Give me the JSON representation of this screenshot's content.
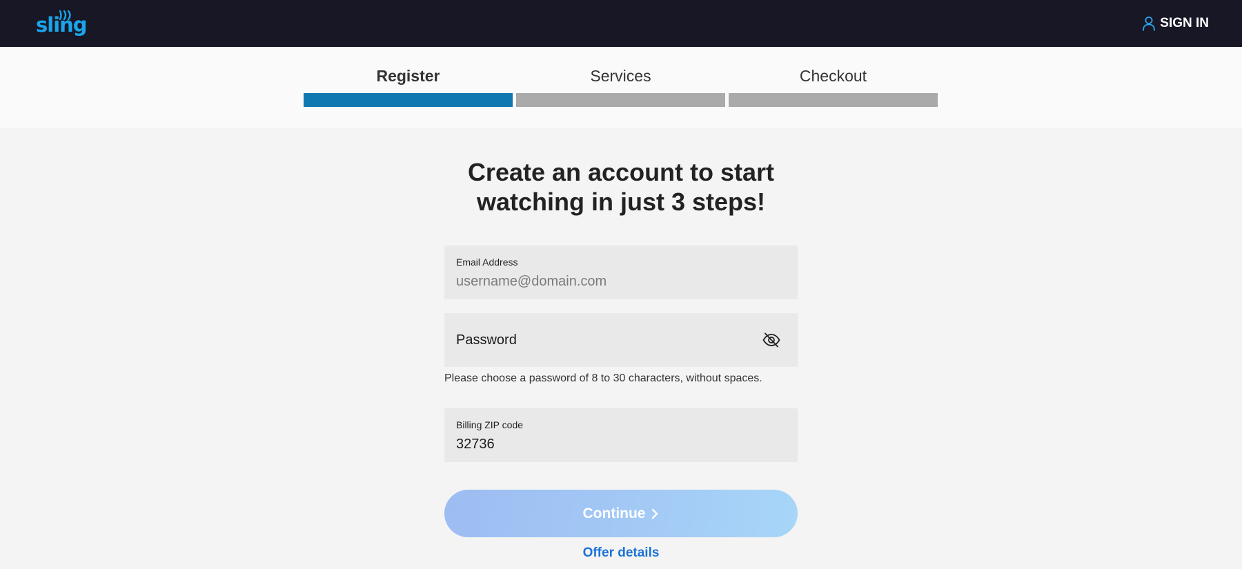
{
  "header": {
    "logo_text": "sling",
    "signin_label": "SIGN IN"
  },
  "stepper": {
    "steps": [
      {
        "label": "Register",
        "active": true
      },
      {
        "label": "Services",
        "active": false
      },
      {
        "label": "Checkout",
        "active": false
      }
    ],
    "active_color": "#0f78b0",
    "inactive_color": "#aaaaaa"
  },
  "main": {
    "headline_line1": "Create an account to start",
    "headline_line2": "watching in just 3 steps!",
    "email": {
      "label": "Email Address",
      "placeholder": "username@domain.com",
      "value": ""
    },
    "password": {
      "placeholder": "Password",
      "value": "",
      "toggle_icon": "eye-slash-icon",
      "helper": "Please choose a password of 8 to 30 characters, without spaces."
    },
    "zip": {
      "label": "Billing ZIP code",
      "value": "32736"
    },
    "continue_label": "Continue",
    "offer_details_label": "Offer details"
  },
  "colors": {
    "header_bg": "#171726",
    "brand_blue": "#1aa4ea",
    "link_blue": "#1b73d6"
  }
}
